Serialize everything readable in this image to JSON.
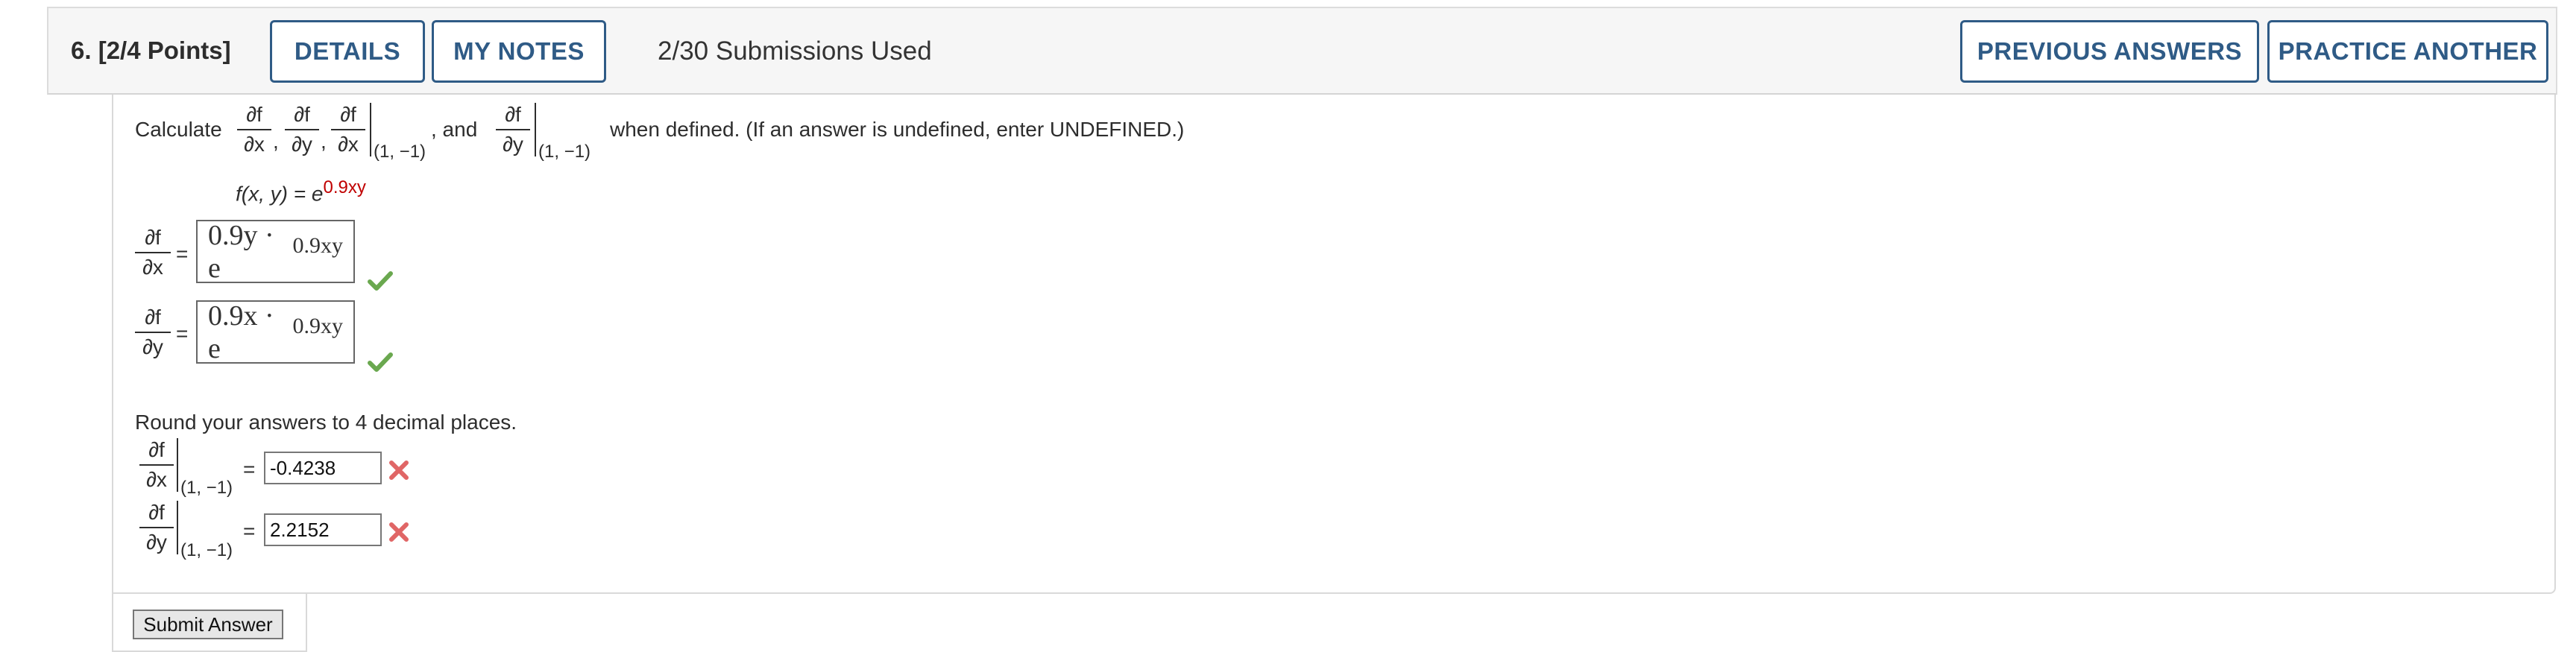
{
  "header": {
    "question_number": "6.",
    "points": "[2/4 Points]",
    "details_label": "DETAILS",
    "my_notes_label": "MY NOTES",
    "submissions": "2/30 Submissions Used",
    "previous_answers_label": "PREVIOUS ANSWERS",
    "practice_another_label": "PRACTICE ANOTHER"
  },
  "prompt": {
    "calculate": "Calculate",
    "partial_f": "∂f",
    "dx": "∂x",
    "dy": "∂y",
    "comma": ",",
    "and": ", and",
    "at_point": "(1, −1)",
    "tail": "when defined. (If an answer is undefined, enter UNDEFINED.)",
    "function_lhs": "f(x, y) = e",
    "function_exp": "0.9xy"
  },
  "answers": {
    "equals": "=",
    "fx_base": "0.9y · e",
    "fx_exp": "0.9xy",
    "fy_base": "0.9x · e",
    "fy_exp": "0.9xy",
    "round_note": "Round your answers to 4 decimal places.",
    "fx_value": "-0.4238",
    "fy_value": "2.2152"
  },
  "submit_label": "Submit Answer",
  "colors": {
    "accent": "#2f5b86",
    "correct": "#6aa84f",
    "incorrect": "#e06666",
    "exponent": "#c00000"
  }
}
